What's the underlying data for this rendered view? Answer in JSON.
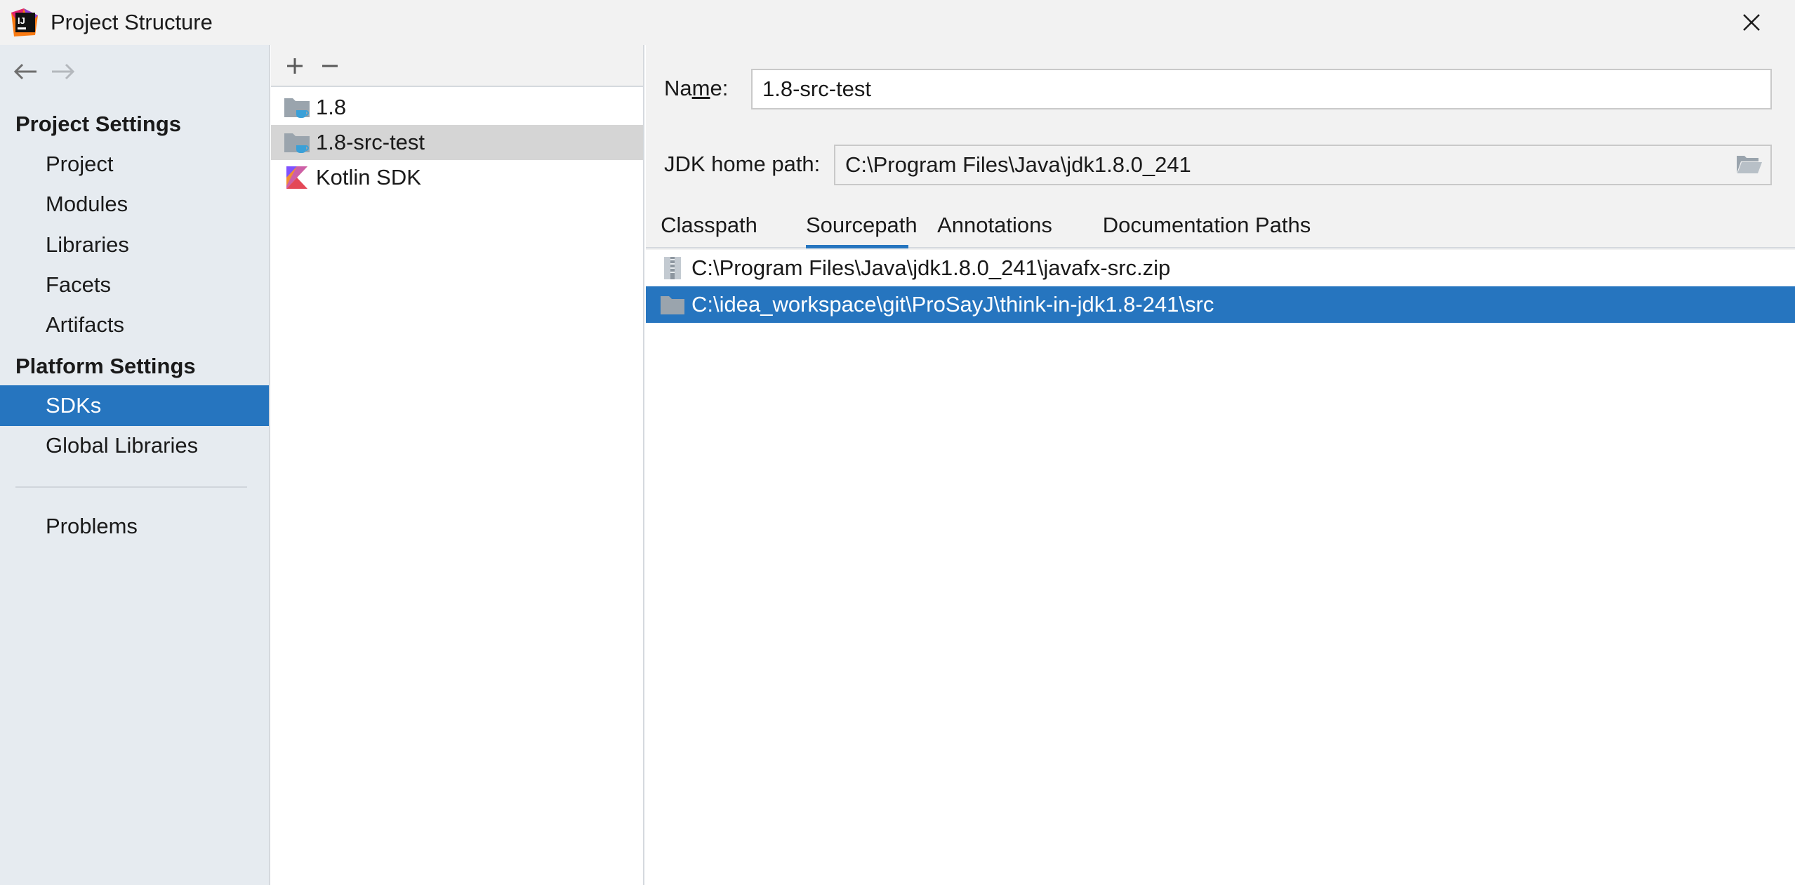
{
  "window": {
    "title": "Project Structure",
    "icons": {
      "app": "intellij-idea-logo",
      "close": "close-icon"
    }
  },
  "sidebar": {
    "nav": {
      "back": "back-arrow-icon",
      "forward": "forward-arrow-icon"
    },
    "project_settings_label": "Project Settings",
    "project_items": [
      "Project",
      "Modules",
      "Libraries",
      "Facets",
      "Artifacts"
    ],
    "platform_settings_label": "Platform Settings",
    "platform_items": [
      "SDKs",
      "Global Libraries"
    ],
    "selected": "SDKs",
    "problems_label": "Problems"
  },
  "sdk_list": {
    "toolbar": {
      "add_icon": "plus-icon",
      "remove_icon": "minus-icon"
    },
    "items": [
      {
        "label": "1.8",
        "icon": "jdk-folder-icon"
      },
      {
        "label": "1.8-src-test",
        "icon": "jdk-folder-icon",
        "selected": true
      },
      {
        "label": "Kotlin SDK",
        "icon": "kotlin-icon"
      }
    ]
  },
  "detail": {
    "name_label_pre": "Na",
    "name_label_mnemonic": "m",
    "name_label_post": "e:",
    "name_value": "1.8-src-test",
    "jdk_home_label": "JDK home path:",
    "jdk_home_value": "C:\\Program Files\\Java\\jdk1.8.0_241",
    "browse_icon": "folder-open-icon",
    "tabs": [
      "Classpath",
      "Sourcepath",
      "Annotations",
      "Documentation Paths"
    ],
    "active_tab": "Sourcepath",
    "paths": [
      {
        "label": "C:\\Program Files\\Java\\jdk1.8.0_241\\javafx-src.zip",
        "icon": "archive-icon"
      },
      {
        "label": "C:\\idea_workspace\\git\\ProSayJ\\think-in-jdk1.8-241\\src",
        "icon": "folder-icon",
        "selected": true
      }
    ]
  },
  "colors": {
    "selection_blue": "#2675bf",
    "sidebar_bg": "#e6ebf0",
    "panel_bg": "#f2f2f2",
    "list_selected_gray": "#d5d5d5"
  }
}
